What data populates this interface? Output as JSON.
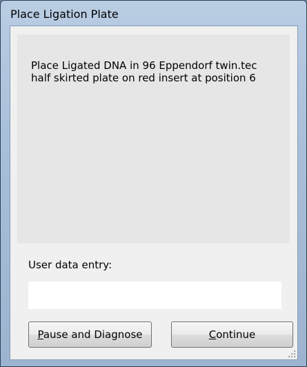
{
  "window": {
    "title": "Place Ligation Plate"
  },
  "message": {
    "text": "Place Ligated DNA in 96 Eppendorf twin.tec\nhalf skirted plate on red insert at position 6"
  },
  "user_entry": {
    "label": "User data entry:",
    "value": ""
  },
  "buttons": {
    "pause_label": "Pause and Diagnose",
    "continue_label": "Continue"
  },
  "colors": {
    "window_frame": "#a8bfd9",
    "client_background": "#f0f0f0",
    "message_panel": "#e6e6e6"
  }
}
